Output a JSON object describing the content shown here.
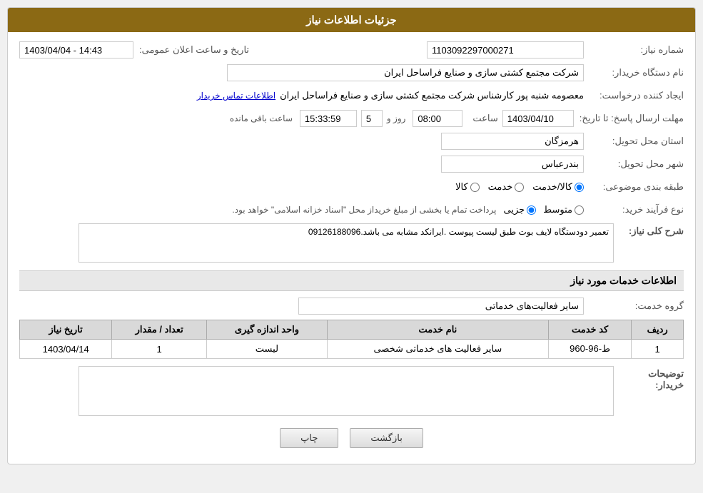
{
  "header": {
    "title": "جزئیات اطلاعات نیاز"
  },
  "fields": {
    "need_number_label": "شماره نیاز:",
    "need_number_value": "1103092297000271",
    "buyer_org_label": "نام دستگاه خریدار:",
    "buyer_org_value": "شرکت مجتمع کشتی سازی و صنایع فراساحل ایران",
    "creator_label": "ایجاد کننده درخواست:",
    "creator_value": "معصومه شنبه پور کارشناس شرکت مجتمع کشتی سازی و صنایع فراساحل ایران",
    "creator_link": "اطلاعات تماس خریدار",
    "public_date_label": "تاریخ و ساعت اعلان عمومی:",
    "public_date_value": "1403/04/04 - 14:43",
    "response_deadline_label": "مهلت ارسال پاسخ: تا تاریخ:",
    "response_date": "1403/04/10",
    "response_time_label": "ساعت",
    "response_time": "08:00",
    "remaining_days_label": "روز و",
    "remaining_days": "5",
    "remaining_time_label": "ساعت باقی مانده",
    "remaining_time": "15:33:59",
    "province_label": "استان محل تحویل:",
    "province_value": "هرمزگان",
    "city_label": "شهر محل تحویل:",
    "city_value": "بندرعباس",
    "category_label": "طبقه بندی موضوعی:",
    "category_goods": "کالا",
    "category_service": "خدمت",
    "category_goods_service": "کالا/خدمت",
    "category_selected": "کالا/خدمت",
    "purchase_type_label": "نوع فرآیند خرید:",
    "purchase_type_partial": "جزیی",
    "purchase_type_medium": "متوسط",
    "purchase_type_note": "پرداخت تمام یا بخشی از مبلغ خریداز محل \"اسناد خزانه اسلامی\" خواهد بود.",
    "need_desc_label": "شرح کلی نیاز:",
    "need_desc_value": "تعمیر دودستگاه لایف بوت طبق لیست پیوست .ایرانکد مشابه می باشد.09126188096",
    "services_section_label": "اطلاعات خدمات مورد نیاز",
    "service_group_label": "گروه خدمت:",
    "service_group_value": "سایر فعالیت‌های خدماتی",
    "table": {
      "headers": [
        "ردیف",
        "کد خدمت",
        "نام خدمت",
        "واحد اندازه گیری",
        "تعداد / مقدار",
        "تاریخ نیاز"
      ],
      "rows": [
        {
          "row_num": "1",
          "service_code": "ط-96-960",
          "service_name": "سایر فعالیت های خدماتی شخصی",
          "unit": "لیست",
          "quantity": "1",
          "date_needed": "1403/04/14"
        }
      ]
    },
    "buyer_desc_label": "توضیحات خریدار:",
    "buyer_desc_value": ""
  },
  "buttons": {
    "print_label": "چاپ",
    "back_label": "بازگشت"
  },
  "colors": {
    "header_bg": "#8B6914",
    "section_header_bg": "#e8e8e8"
  }
}
